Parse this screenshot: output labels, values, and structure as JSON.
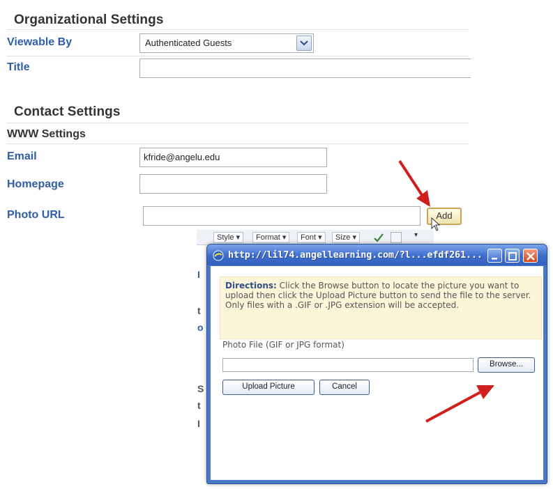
{
  "org_settings": {
    "heading": "Organizational Settings",
    "viewable_by": {
      "label": "Viewable By",
      "selected": "Authenticated Guests"
    },
    "title": {
      "label": "Title",
      "value": ""
    }
  },
  "contact_settings": {
    "heading": "Contact Settings",
    "www_heading": "WWW Settings",
    "email": {
      "label": "Email",
      "value": "kfride@angelu.edu"
    },
    "homepage": {
      "label": "Homepage",
      "value": ""
    },
    "photo_url": {
      "label": "Photo URL",
      "value": "",
      "add_button": "Add"
    }
  },
  "editor_toolbar": {
    "style": "Style ▾",
    "format": "Format ▾",
    "font": "Font ▾",
    "size": "Size ▾"
  },
  "popup": {
    "title": "http://lil74.angellearning.com/?l...efdf261...",
    "directions_label": "Directions:",
    "directions_text": " Click the Browse button to locate the picture you want to upload then click the Upload Picture button to send the file to the server. Only files with a .GIF or .JPG extension will be accepted.",
    "photo_file_label": "Photo File (GIF or JPG format)",
    "photo_file_value": "",
    "browse_button": "Browse...",
    "upload_button": "Upload Picture",
    "cancel_button": "Cancel"
  },
  "colors": {
    "label_blue": "#2f5da6",
    "title_bar_blue": "#3e6ccb",
    "annotation_arrow": "#d0201c",
    "directions_bg": "#fdf5d8"
  }
}
